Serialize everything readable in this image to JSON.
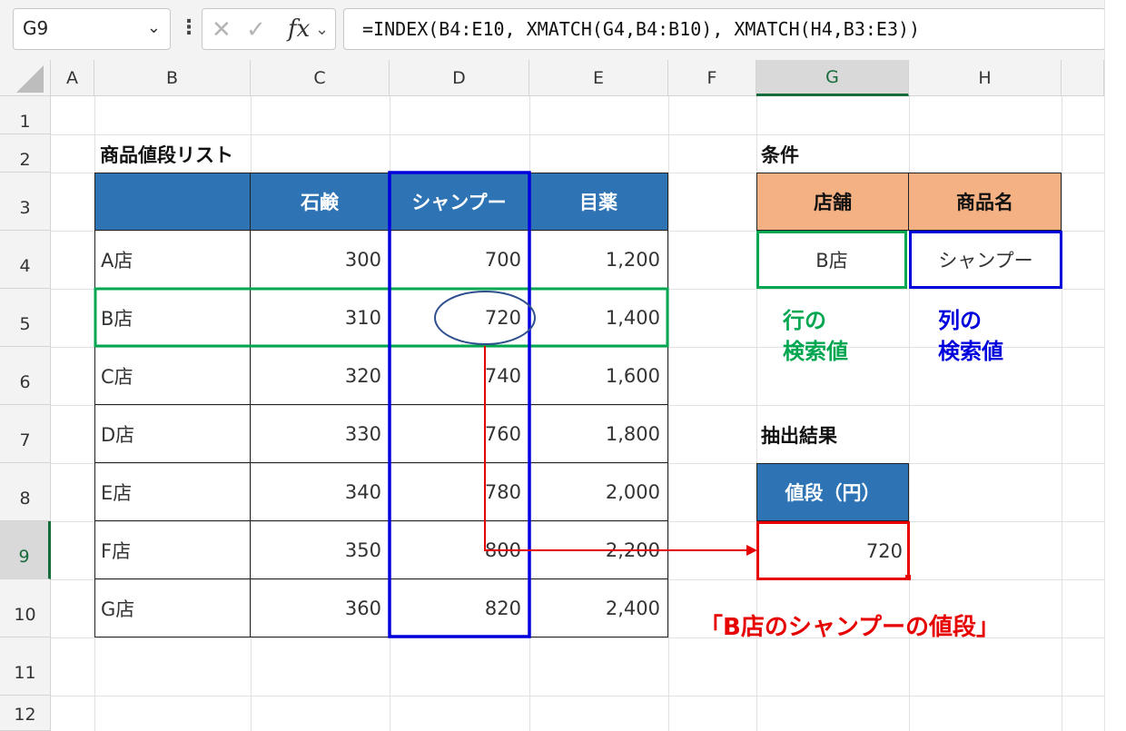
{
  "formula_bar": {
    "name_box": "G9",
    "cancel_glyph": "✕",
    "enter_glyph": "✓",
    "fx_label": "fx",
    "formula": "=INDEX(B4:E10, XMATCH(G4,B4:B10), XMATCH(H4,B3:E3))"
  },
  "columns": [
    "A",
    "B",
    "C",
    "D",
    "E",
    "F",
    "G",
    "H"
  ],
  "rows": [
    "1",
    "2",
    "3",
    "4",
    "5",
    "6",
    "7",
    "8",
    "9",
    "10",
    "11",
    "12"
  ],
  "selected_cell": {
    "column": "G",
    "row": "9"
  },
  "table": {
    "title": "商品値段リスト",
    "headers": [
      "",
      "石鹸",
      "シャンプー",
      "目薬"
    ],
    "rows": [
      [
        "A店",
        "300",
        "700",
        "1,200"
      ],
      [
        "B店",
        "310",
        "720",
        "1,400"
      ],
      [
        "C店",
        "320",
        "740",
        "1,600"
      ],
      [
        "D店",
        "330",
        "760",
        "1,800"
      ],
      [
        "E店",
        "340",
        "780",
        "2,000"
      ],
      [
        "F店",
        "350",
        "800",
        "2,200"
      ],
      [
        "G店",
        "360",
        "820",
        "2,400"
      ]
    ]
  },
  "conditions": {
    "title": "条件",
    "headers": [
      "店舗",
      "商品名"
    ],
    "values": [
      "B店",
      "シャンプー"
    ],
    "row_note": [
      "行の",
      "検索値"
    ],
    "col_note": [
      "列の",
      "検索値"
    ]
  },
  "result": {
    "title": "抽出結果",
    "header": "値段（円）",
    "value": "720",
    "caption": "「B店のシャンプーの値段」"
  },
  "colors": {
    "header_blue": "#2e74b5",
    "condition_orange": "#f4b183",
    "row_highlight_green": "#00a650",
    "column_highlight_blue": "#0000dd",
    "result_red": "#e60000"
  }
}
